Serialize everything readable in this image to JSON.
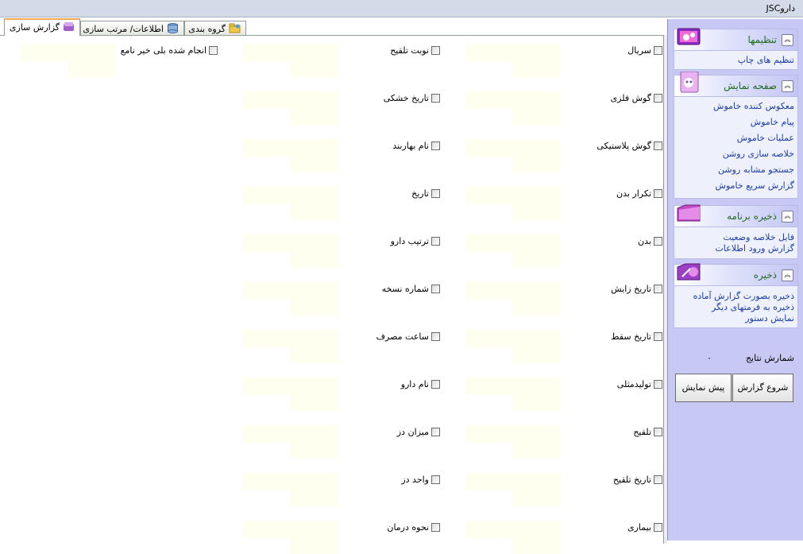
{
  "window": {
    "title": "داروJSC"
  },
  "tabs": [
    {
      "label": "گزارش سازی",
      "icon": "report-icon"
    },
    {
      "label": "اطلاعات/ مرتب سازی",
      "icon": "database-icon"
    },
    {
      "label": "گروه بندی",
      "icon": "folder-icon"
    }
  ],
  "fields": {
    "col1": [
      "سریال",
      "گوش فلزی",
      "گوش پلاستیکی",
      "تکرار بدن",
      "بدن",
      "تاریخ زایش",
      "تاریخ سقط",
      "تولیدمثلی",
      "تلقیح",
      "تاریخ تلقیح",
      "بیماری"
    ],
    "col2": [
      "نوبت تلقیح",
      "تاریخ خشکی",
      "نام بهاربند",
      "تاریخ",
      "ترتیب دارو",
      "شماره نسخه",
      "ساعت مصرف",
      "نام دارو",
      "میزان دز",
      "واحد دز",
      "نحوه درمان"
    ],
    "col3": [
      "انجام شده بلی خیر نامع"
    ]
  },
  "side": {
    "settings": {
      "title": "تنظیمها",
      "items": [
        "تنظیم های چاپ"
      ]
    },
    "display": {
      "title": "صفحه نمایش",
      "items": [
        "معکوس کننده خاموش",
        "پیام خاموش",
        "عملیات خاموش",
        "خلاصه سازی روشن",
        "جستجو مشابه روشن",
        "گزارش سریع خاموش"
      ]
    },
    "save_program": {
      "title": "ذخیره برنامه",
      "items": [
        "فایل خلاصه وضعیت",
        "گزارش ورود اطلاعات"
      ]
    },
    "save": {
      "title": "ذخیره",
      "items": [
        "ذخیره بصورت گزارش آماده",
        "ذخیره به فرمتهای دیگر",
        "نمایش دستور"
      ]
    },
    "result_count_label": "شمارش نتایج",
    "result_count_value": "۰",
    "start_button": "شروع گزارش",
    "preview_button": "پیش نمایش"
  }
}
